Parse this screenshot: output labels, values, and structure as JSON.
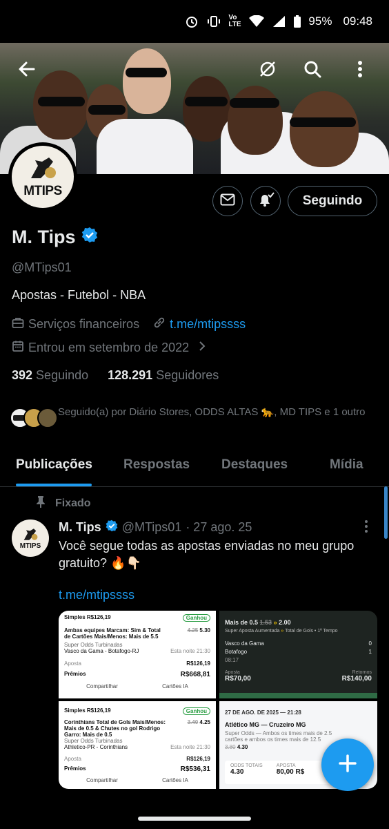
{
  "status_bar": {
    "battery": "95%",
    "time": "09:48",
    "network": "Vo LTE"
  },
  "profile": {
    "name": "M. Tips",
    "handle": "@MTips01",
    "bio": "Apostas - Futebol - NBA",
    "category": "Serviços financeiros",
    "link": "t.me/mtipssss",
    "joined": "Entrou em setembro de 2022",
    "following_count": "392",
    "following_label": "Seguindo",
    "followers_count": "128.291",
    "followers_label": "Seguidores",
    "followed_by": "Seguido(a) por Diário Stores, ODDS ALTAS 🐆, MD TIPS e 1 outro",
    "follow_button": "Seguindo",
    "avatar_text": "MTIPS"
  },
  "tabs": [
    "Publicações",
    "Respostas",
    "Destaques",
    "Mídia"
  ],
  "post": {
    "pinned_label": "Fixado",
    "author": "M. Tips",
    "handle": "@MTips01",
    "date": "· 27 ago. 25",
    "text": "Você segue todas as apostas enviadas no meu grupo gratuito? 🔥👇🏻",
    "link": "t.me/mtipssss"
  },
  "media": {
    "bet1": {
      "header": "Simples R$126,19",
      "status": "Ganhou",
      "market": "Ambas equipes Marcam: Sim & Total de Cartões Mais/Menos: Mais de 5.5",
      "odd_old": "4.25",
      "odd": "5.30",
      "promo": "Super Odds Turbinadas",
      "match": "Vasco da Gama - Botafogo-RJ",
      "time": "Esta noite 21:30",
      "stake_label": "Aposta",
      "stake": "R$126,19",
      "prize_label": "Prêmios",
      "prize": "R$668,81",
      "share": "Compartilhar",
      "cards": "Cartões IA"
    },
    "bet2": {
      "header": "Simples R$126,19",
      "status": "Ganhou",
      "market": "Corinthians Total de Gols Mais/Menos: Mais de 0.5 & Chutes no gol Rodrigo Garro: Mais de 0.5",
      "odd_old": "3.40",
      "odd": "4.25",
      "promo": "Super Odds Turbinadas",
      "match": "Athletico-PR - Corinthians",
      "time": "Esta noite 21:30",
      "stake_label": "Aposta",
      "stake": "R$126,19",
      "prize_label": "Prêmios",
      "prize": "R$536,31",
      "share": "Compartilhar",
      "cards": "Cartões IA"
    },
    "bet3": {
      "market": "Mais de 0.5",
      "odd_old": "1.53",
      "odd": "2.00",
      "promo": "Super Aposta Aumentada",
      "detail": "Total de Gols • 1º Tempo",
      "team1": "Vasco da Gama",
      "team2": "Botafogo",
      "score1": "0",
      "score2": "1",
      "minute": "08:17",
      "stake_label": "Aposta",
      "stake": "R$70,00",
      "return_label": "Retornos",
      "return": "R$140,00"
    },
    "bet4": {
      "date": "27 DE AGO. DE 2025 — 21:28",
      "match": "Atlético MG — Cruzeiro MG",
      "desc": "Super Odds — Ambos os times mais de 2.5 cartões e ambos os times mais de 12.5",
      "odd_old": "3.80",
      "odd": "4.30",
      "odds_label": "ODDS TOTAIS",
      "odds_value": "4.30",
      "stake_label": "APOSTA",
      "stake_value": "80,00 R$"
    }
  }
}
